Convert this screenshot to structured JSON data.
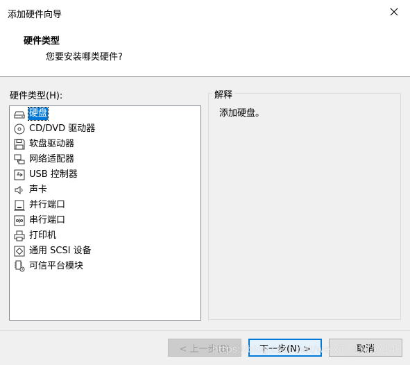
{
  "window": {
    "title": "添加硬件向导",
    "close_icon": "close-icon"
  },
  "header": {
    "title": "硬件类型",
    "subtitle": "您要安装哪类硬件?"
  },
  "hardware_list": {
    "label": "硬件类型(H):",
    "selected_index": 0,
    "items": [
      {
        "label": "硬盘",
        "icon": "hard-disk-icon"
      },
      {
        "label": "CD/DVD 驱动器",
        "icon": "cd-dvd-icon"
      },
      {
        "label": "软盘驱动器",
        "icon": "floppy-icon"
      },
      {
        "label": "网络适配器",
        "icon": "network-adapter-icon"
      },
      {
        "label": "USB 控制器",
        "icon": "usb-icon"
      },
      {
        "label": "声卡",
        "icon": "speaker-icon"
      },
      {
        "label": "并行端口",
        "icon": "parallel-port-icon"
      },
      {
        "label": "串行端口",
        "icon": "serial-port-icon"
      },
      {
        "label": "打印机",
        "icon": "printer-icon"
      },
      {
        "label": "通用 SCSI 设备",
        "icon": "scsi-icon"
      },
      {
        "label": "可信平台模块",
        "icon": "tpm-icon"
      }
    ]
  },
  "description": {
    "label": "解释",
    "text": "添加硬盘。"
  },
  "buttons": {
    "back": "< 上一步(B)",
    "next": "下一步(N) >",
    "cancel": "取消"
  },
  "watermark": "https://blog.csdn.net/weixin_45757140",
  "colors": {
    "selection": "#0078d7",
    "dialog_bg": "#f0f0f0",
    "header_bg": "#ffffff"
  }
}
